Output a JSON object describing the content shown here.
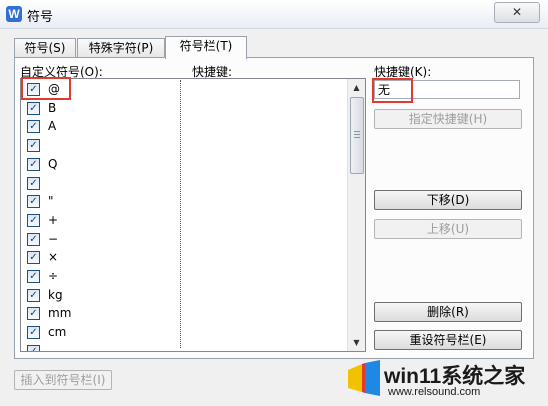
{
  "window": {
    "title": "符号",
    "icon_name": "wps-writer-icon",
    "close_glyph": "✕"
  },
  "tabs": [
    {
      "label": "符号(S)",
      "active": false
    },
    {
      "label": "特殊字符(P)",
      "active": false
    },
    {
      "label": "符号栏(T)",
      "active": true
    }
  ],
  "left_panel": {
    "custom_symbols_label": "自定义符号(O):",
    "shortcut_column_label": "快捷键:",
    "symbols": [
      "@",
      "B",
      "A",
      "",
      "Q",
      "",
      "\"",
      "+",
      "−",
      "×",
      "÷",
      "kg",
      "mm",
      "cm",
      ""
    ],
    "check_glyph": "✓"
  },
  "right_panel": {
    "shortcut_label": "快捷键(K):",
    "shortcut_value": "无",
    "assign_button": "指定快捷键(H)",
    "move_down_button": "下移(D)",
    "move_up_button": "上移(U)",
    "delete_button": "删除(R)",
    "reset_button": "重设符号栏(E)"
  },
  "footer": {
    "insert_button": "插入到符号栏(I)"
  },
  "watermark": {
    "title": "win11系统之家",
    "url": "www.relsound.com"
  },
  "colors": {
    "highlight": "#e23a2e",
    "accent": "#2f6fd6"
  }
}
